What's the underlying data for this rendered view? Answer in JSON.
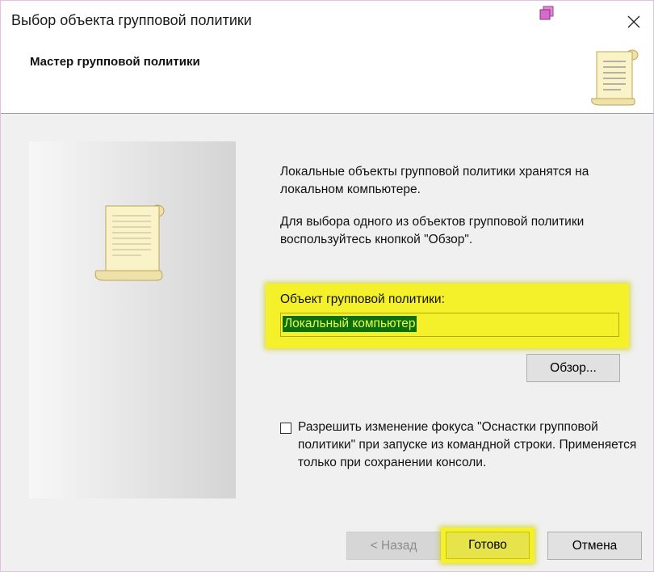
{
  "window": {
    "title": "Выбор объекта групповой политики",
    "header_title": "Мастер групповой политики"
  },
  "icons": {
    "app": "gpo-app-icon",
    "close": "close-icon",
    "header_scroll": "scroll-icon",
    "side_scroll": "scroll-icon"
  },
  "content": {
    "description_1": "Локальные объекты групповой политики хранятся на локальном компьютере.",
    "description_2": "Для выбора одного из объектов групповой политики воспользуйтесь кнопкой \"Обзор\".",
    "gpo_label": "Объект групповой политики:",
    "gpo_value": "Локальный компьютер",
    "browse_label": "Обзор...",
    "checkbox_label": "Разрешить изменение фокуса \"Оснастки групповой политики\" при запуске из командной строки. Применяется только при сохранении консоли.",
    "checkbox_checked": false
  },
  "buttons": {
    "back": "< Назад",
    "finish": "Готово",
    "cancel": "Отмена"
  },
  "colors": {
    "highlight": "#f4f02a",
    "selection_bg": "#0b6f0e",
    "selection_text": "#e8ff4a"
  }
}
